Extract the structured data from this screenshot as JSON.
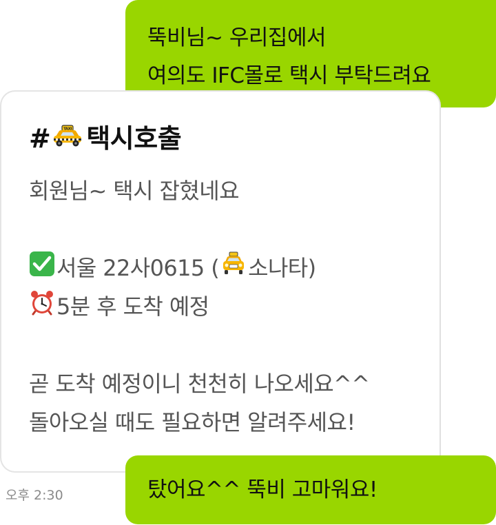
{
  "outgoing_top": {
    "line1": "뚝비님~ 우리집에서",
    "line2": "여의도 IFC몰로 택시 부탁드려요"
  },
  "incoming": {
    "title_prefix": "#",
    "title_text": "택시호출",
    "greeting": "회원님~ 택시 잡혔네요",
    "plate_text": "서울 22사0615 (",
    "car_model": "소나타)",
    "eta_text": "5분 후 도착 예정",
    "notice1": "곧 도착 예정이니 천천히 나오세요^^",
    "notice2": "돌아오실 때도 필요하면 알려주세요!"
  },
  "timestamp": "오후 2:30",
  "outgoing_bottom": {
    "text": "탔어요^^ 뚝비 고마워요!"
  },
  "icons": {
    "title_icon": "taxi-icon",
    "plate_icon": "check-mark-icon",
    "car_icon": "oncoming-taxi-icon",
    "eta_icon": "alarm-clock-icon"
  },
  "colors": {
    "outgoing_bubble": "#99d600",
    "incoming_text": "#555555",
    "check_green": "#3ab54a"
  }
}
